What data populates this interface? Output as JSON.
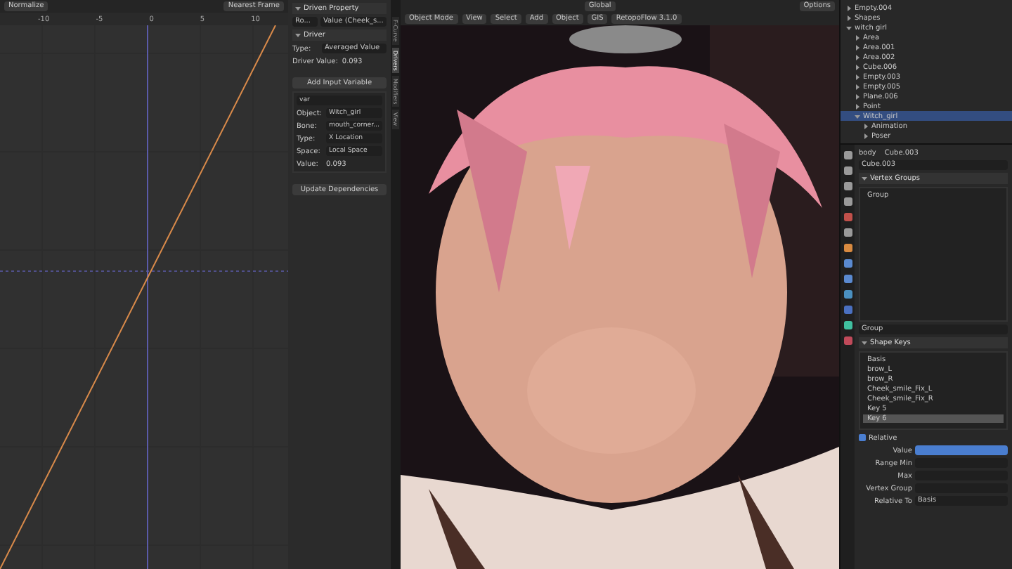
{
  "graph_editor": {
    "header": {
      "normalize": "Normalize",
      "snap": "Nearest Frame"
    },
    "ruler": [
      "-10",
      "-5",
      "0",
      "5",
      "10"
    ]
  },
  "sidebar": {
    "tabs": [
      {
        "label": "F-Curve",
        "selected": false
      },
      {
        "label": "Drivers",
        "selected": true
      },
      {
        "label": "Modifiers",
        "selected": false
      },
      {
        "label": "View",
        "selected": false
      }
    ],
    "driven_property": {
      "title": "Driven Property",
      "object": "Ro...",
      "property": "Value (Cheek_s..."
    },
    "driver": {
      "title": "Driver",
      "type_label": "Type:",
      "type": "Averaged Value",
      "value_label": "Driver Value:",
      "value": "0.093",
      "add_button": "Add Input Variable",
      "variable": {
        "name": "var",
        "fields": [
          {
            "label": "Object:",
            "value": "Witch_girl"
          },
          {
            "label": "Bone:",
            "value": "mouth_corner..."
          }
        ],
        "selects": [
          {
            "label": "Type:",
            "value": "X Location"
          },
          {
            "label": "Space:",
            "value": "Local Space"
          }
        ],
        "value_label": "Value:",
        "value": "0.093"
      },
      "update_button": "Update Dependencies"
    }
  },
  "viewport": {
    "top_bar": {
      "orientation": "Global",
      "options": "Options"
    },
    "menus": [
      "Object Mode",
      "View",
      "Select",
      "Add",
      "Object",
      "GIS",
      "RetopoFlow 3.1.0"
    ],
    "kind": "picture"
  },
  "outliner": {
    "items": [
      {
        "label": "Empty.004",
        "expanded": false,
        "selected": false
      },
      {
        "label": "Shapes",
        "expanded": false,
        "selected": false
      },
      {
        "label": "witch girl",
        "expanded": true,
        "selected": false,
        "children": [
          {
            "label": "Area",
            "expanded": false,
            "selected": false
          },
          {
            "label": "Area.001",
            "expanded": false,
            "selected": false
          },
          {
            "label": "Area.002",
            "expanded": false,
            "selected": false
          },
          {
            "label": "Cube.006",
            "expanded": false,
            "selected": false
          },
          {
            "label": "Empty.003",
            "expanded": false,
            "selected": false
          },
          {
            "label": "Empty.005",
            "expanded": false,
            "selected": false
          },
          {
            "label": "Plane.006",
            "expanded": false,
            "selected": false
          },
          {
            "label": "Point",
            "expanded": false,
            "selected": false
          },
          {
            "label": "Witch_girl",
            "expanded": true,
            "selected": true,
            "children": [
              {
                "label": "Animation",
                "expanded": false,
                "selected": false
              },
              {
                "label": "Poser",
                "expanded": false,
                "selected": false
              }
            ]
          }
        ]
      }
    ]
  },
  "properties": {
    "breadcrumb": [
      "body",
      "Cube.003"
    ],
    "mesh_name": "Cube.003",
    "vertex_groups": {
      "title": "Vertex Groups",
      "items": [
        "Group"
      ],
      "field": "Group"
    },
    "shape_keys": {
      "title": "Shape Keys",
      "items": [
        {
          "label": "Basis",
          "selected": false
        },
        {
          "label": "brow_L",
          "selected": false
        },
        {
          "label": "brow_R",
          "selected": false
        },
        {
          "label": "Cheek_smile_Fix_L",
          "selected": false
        },
        {
          "label": "Cheek_smile_Fix_R",
          "selected": false
        },
        {
          "label": "Key 5",
          "selected": false
        },
        {
          "label": "Key 6",
          "selected": true
        }
      ],
      "relative": {
        "label": "Relative",
        "checked": true
      },
      "value": {
        "label": "Value",
        "level": 1
      },
      "labels": [
        "Range Min",
        "Max",
        "Vertex Group"
      ],
      "relative_to": {
        "label": "Relative To",
        "value": "Basis"
      }
    }
  }
}
